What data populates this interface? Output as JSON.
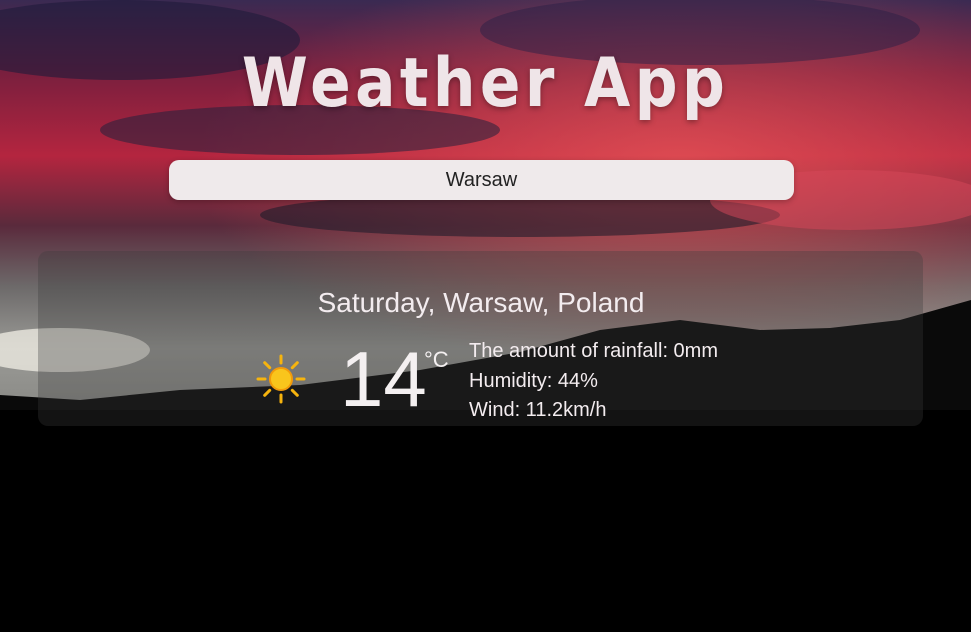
{
  "app_title": "Weather App",
  "search": {
    "value": "Warsaw"
  },
  "weather": {
    "date_location": "Saturday, Warsaw, Poland",
    "icon": "sun-icon",
    "temperature": "14",
    "unit": "°C",
    "rainfall": "The amount of rainfall: 0mm",
    "humidity": "Humidity: 44%",
    "wind": "Wind: 11.2km/h"
  },
  "colors": {
    "sky_red": "#c0213a",
    "sky_dark": "#2b2045",
    "sun": "#f6b40e"
  }
}
